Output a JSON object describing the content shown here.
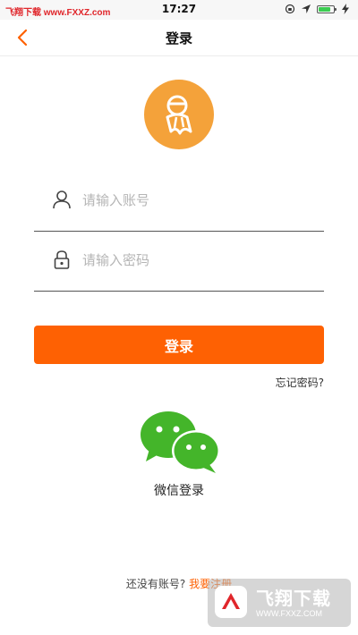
{
  "status_bar": {
    "site": "飞翔下载 www.FXXZ.com",
    "time": "17:27"
  },
  "navbar": {
    "back_icon": "chevron-left-icon",
    "title": "登录"
  },
  "colors": {
    "accent": "#fe6103",
    "avatar_bg": "#f4a23a",
    "wechat_green": "#44b52a"
  },
  "form": {
    "username": {
      "placeholder": "请输入账号",
      "value": "",
      "icon": "user-icon"
    },
    "password": {
      "placeholder": "请输入密码",
      "value": "",
      "icon": "lock-icon"
    },
    "login_label": "登录",
    "forgot_label": "忘记密码?"
  },
  "wechat": {
    "icon": "wechat-icon",
    "label": "微信登录"
  },
  "footer": {
    "prompt": "还没有账号?",
    "register_label": "我要注册"
  },
  "watermark": {
    "text": "飞翔下载",
    "url": "WWW.FXXZ.COM"
  }
}
